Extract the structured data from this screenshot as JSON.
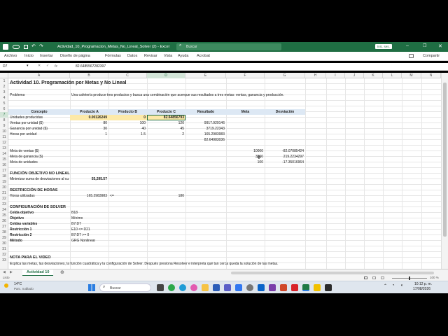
{
  "window": {
    "title": "Actividad_10_Programacion_Metas_No_Lineal_Solver (2) - Excel",
    "search_placeholder": "Buscar",
    "user": "Inic. ses."
  },
  "menu": {
    "items": [
      "Archivo",
      "Inicio",
      "Insertar",
      "Diseño de página",
      "Fórmulas",
      "Datos",
      "Revisar",
      "Vista",
      "Ayuda",
      "Acrobat"
    ],
    "share": "Compartir"
  },
  "formula_bar": {
    "name_box": "D7",
    "fx": "fx",
    "content": "82.6485567282397"
  },
  "columns": [
    "A",
    "B",
    "C",
    "D",
    "E",
    "F",
    "G",
    "H",
    "I",
    "J",
    "K",
    "L",
    "M",
    "N"
  ],
  "rows": [
    "1",
    "2",
    "3",
    "4",
    "5",
    "6",
    "7",
    "8",
    "9",
    "10",
    "11",
    "12",
    "13",
    "14",
    "15",
    "16",
    "17",
    "18",
    "19",
    "20",
    "21",
    "22",
    "23",
    "24",
    "25",
    "26",
    "27",
    "28",
    "29",
    "30",
    "31",
    "32",
    "33"
  ],
  "sheet": {
    "title": "Actividad 10. Programación por Metas y No Lineal",
    "problema_label": "Problema",
    "problema_text": "Una cafetería produce tres productos y busca una combinación que acerque sus resultados a tres metas: ventas, ganancia y producción.",
    "headers": {
      "concepto": "Concepto",
      "producto_a": "Producto A",
      "producto_b": "Producto B",
      "producto_c": "Producto C",
      "resultado": "Resultado",
      "meta": "Meta",
      "desviacion": "Desviación"
    },
    "row7": {
      "label": "Unidades producidas",
      "a": "0.00126249",
      "b": "0",
      "c": "82.64856793"
    },
    "row8": {
      "label": "Ventas por unidad ($)",
      "a": "80",
      "b": "100",
      "c": "120",
      "res": "9917.929146"
    },
    "row9": {
      "label": "Ganancia por unidad ($)",
      "a": "30",
      "b": "40",
      "c": "45",
      "res": "3719.22343"
    },
    "row10": {
      "label": "Horas por unidad",
      "a": "1",
      "b": "1.5",
      "c": "2",
      "res": "165.2983983"
    },
    "row11": {
      "res": "82.64983036"
    },
    "row13": {
      "label": "Meta de ventas ($)",
      "meta": "10000",
      "desv": "-82.07085424"
    },
    "row14": {
      "label": "Meta de ganancia ($)",
      "meta": "3500",
      "desv": "219.2234297"
    },
    "row15": {
      "label": "Meta de unidades",
      "meta": "100",
      "desv": "-17.35016964"
    },
    "row17": "FUNCIÓN OBJETIVO NO LINEAL",
    "row18": {
      "label": "Minimizar suma de desviaciones al cu",
      "val": "55,295.57"
    },
    "row20": "RESTRICCIÓN DE HORAS",
    "row21": {
      "label": "Horas utilizadas",
      "val": "165.2983983",
      "op": "<=",
      "limit": "180"
    },
    "row23": "CONFIGURACIÓN DE SOLVER",
    "solver": [
      {
        "label": "Celda objetivo",
        "value": "B18"
      },
      {
        "label": "Objetivo",
        "value": "Mínimo"
      },
      {
        "label": "Celdas variables",
        "value": "B7:D7"
      },
      {
        "label": "Restricción 1",
        "value": "E10 <= D21"
      },
      {
        "label": "Restricción 2",
        "value": "B7:D7 >= 0"
      },
      {
        "label": "Método",
        "value": "GRG Nonlinear"
      }
    ],
    "row32": "NOTA PARA EL VIDEO",
    "row33": "Explica las metas, las desviaciones, la función cuadrática y la configuración de Solver. Después presiona Resolver e interpreta qué tan cerca queda la solución de las metas."
  },
  "sheet_tab": "Actividad 10",
  "status": {
    "left": "Listo",
    "zoom": "100 %"
  },
  "taskbar": {
    "weather_temp": "14°C",
    "weather_desc": "Parc. nublado",
    "search": "Buscar",
    "time": "10:12 p. m.",
    "date": "17/08/2026"
  },
  "colors": {
    "excel_green": "#1f6e43",
    "header_fill": "#dde8f4",
    "highlight_fill": "#fde9a8"
  }
}
